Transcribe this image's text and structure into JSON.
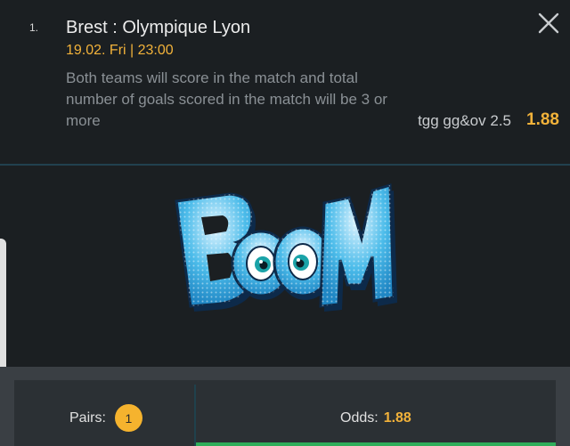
{
  "match": {
    "number": "1.",
    "title": "Brest : Olympique Lyon",
    "datetime": "19.02. Fri | 23:00",
    "description": "Both teams will score in the match and total number of goals scored in the match will be 3 or more",
    "bet_code": "tgg gg&ov 2.5",
    "odds": "1.88"
  },
  "close_icon": "close-icon",
  "boom": {
    "word": "BOOM",
    "colors": {
      "fill": "#3fb6e8",
      "outline": "#0d2a4a",
      "shadow": "#1c6ea3"
    }
  },
  "footer": {
    "pairs_label": "Pairs:",
    "pairs_count": "1",
    "odds_label": "Odds:",
    "odds_value": "1.88"
  },
  "colors": {
    "accent": "#f2b23a",
    "background": "#1b1f22",
    "panel": "#2b3034",
    "divider": "#21414f",
    "confirm": "#2fae5a"
  }
}
